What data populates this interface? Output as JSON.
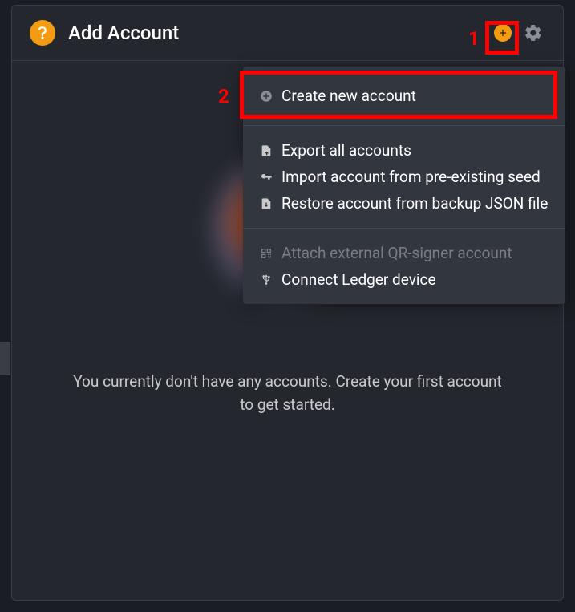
{
  "header": {
    "title": "Add Account"
  },
  "menu": {
    "create_label": "Create new account",
    "export_label": "Export all accounts",
    "import_seed_label": "Import account from pre-existing seed",
    "restore_json_label": "Restore account from backup JSON file",
    "attach_qr_label": "Attach external QR-signer account",
    "connect_ledger_label": "Connect Ledger device"
  },
  "empty_state": "You currently don't have any accounts. Create your first account to get started.",
  "annotations": {
    "step1": "1",
    "step2": "2"
  }
}
